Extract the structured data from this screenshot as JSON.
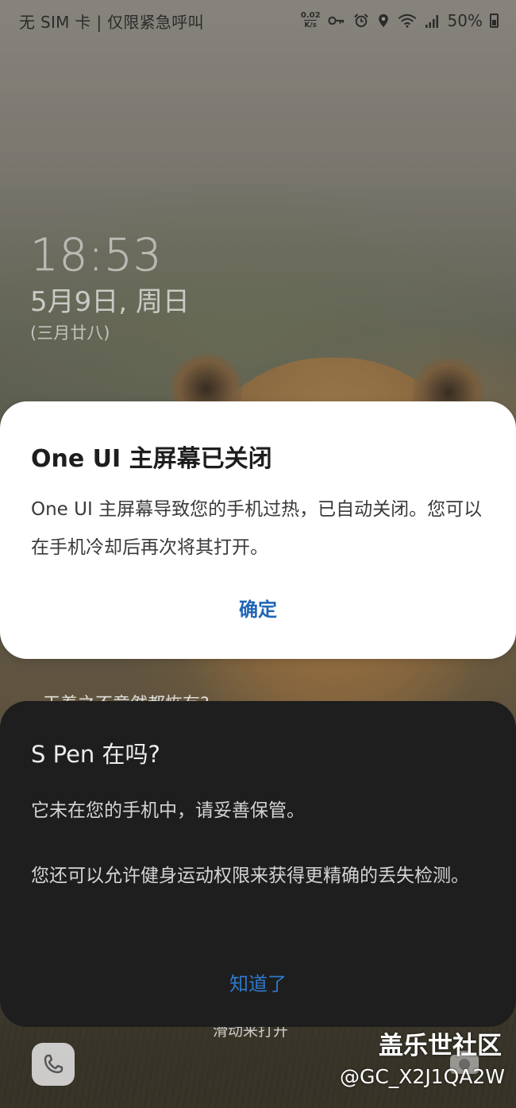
{
  "status_bar": {
    "carrier": "无 SIM 卡 | 仅限紧急呼叫",
    "net_speed_value": "0.02",
    "net_speed_unit": "K/s",
    "battery": "50%",
    "icons": [
      "key-icon",
      "alarm-icon",
      "location-icon",
      "wifi-icon",
      "signal-icon",
      "battery-icon"
    ]
  },
  "lock_screen": {
    "time": "18:53",
    "date": "5月9日, 周日",
    "lunar_date": "(三月廿八)",
    "partially_hidden_text": "干着之不意然都恢有?",
    "swipe_hint": "滑动来打开"
  },
  "dialog_home": {
    "title": "One UI 主屏幕已关闭",
    "message": "One UI 主屏幕导致您的手机过热，已自动关闭。您可以在手机冷却后再次将其打开。",
    "confirm_label": "确定",
    "accent_color": "#1f66b5"
  },
  "dialog_spen": {
    "title": "S Pen 在吗?",
    "message_line1": "它未在您的手机中，请妥善保管。",
    "message_line2": "您还可以允许健身运动权限来获得更精确的丢失检测。",
    "confirm_label": "知道了",
    "accent_color": "#2f78c8"
  },
  "shortcuts": {
    "left_icon": "phone-icon",
    "right_icon": "camera-icon"
  },
  "watermark": {
    "brand": "盖乐世社区",
    "user": "@GC_X2J1QA2W"
  }
}
